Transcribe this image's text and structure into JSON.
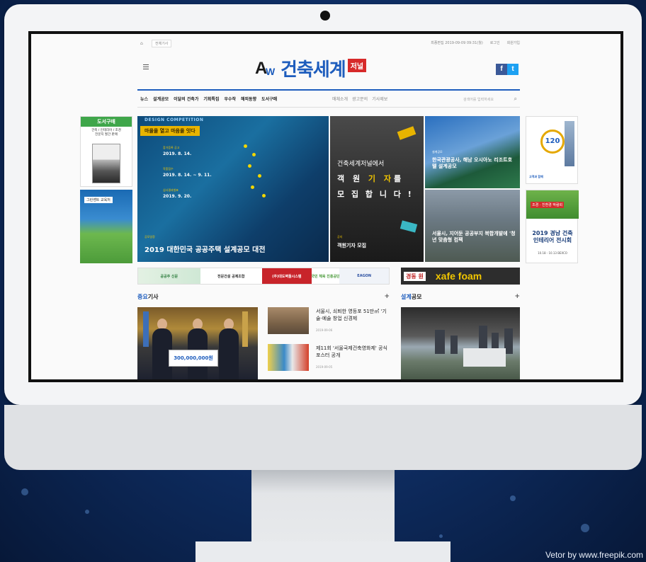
{
  "credit": "Vetor by www.freepik.com",
  "site": {
    "topbar": {
      "home_icon": "home-icon",
      "view_all": "전체기사",
      "right_links": [
        "최종편집 2019-09-09 09:31(월)",
        "로그인",
        "회원가입"
      ]
    },
    "logo": {
      "mark_a": "A",
      "mark_w": "W",
      "name": "건축세계",
      "badge": "저널"
    },
    "social": {
      "facebook": "f",
      "twitter": "t"
    },
    "nav": {
      "items": [
        "뉴스",
        "설계공모",
        "이달의 건축가",
        "기획특집",
        "우수작",
        "해외동향",
        "도서구매"
      ],
      "sub_items": [
        "매체소개",
        "광고문의",
        "기사제보"
      ],
      "search_placeholder": "검색어를 입력하세요"
    },
    "ads_left": {
      "book_header": "도서구매",
      "book_sub": "건축 / 인테리어 / 조경\n전문지 월간 판매",
      "second_tag": "그린쌩트 교육처"
    },
    "ads_right": {
      "anniv_num": "120",
      "anniv_caption": "고객과 함께",
      "exhibit_highlight": "조경 · 친환경 박람회",
      "exhibit_title": "2019 경남 건축\n인테리어 전시회",
      "exhibit_date": "10.18 - 10.13  BEXCO"
    },
    "hero": {
      "main": {
        "label": "DESIGN COMPETITION",
        "slogan": "마을을 열고 마음을 잇다",
        "schedule": [
          {
            "stage": "참가등록 공고",
            "date": "2019. 8. 14."
          },
          {
            "stage": "작품접수",
            "date": "2019. 8. 14. ~ 9. 11."
          },
          {
            "stage": "심사결과발표",
            "date": "2019. 9. 20."
          }
        ],
        "category": "공모일정",
        "title": "2019 대한민국 공공주택 설계공모 대전"
      },
      "middle": {
        "line1": "건축세계저널에서",
        "line2_a": "객 원 ",
        "line2_b": "기 자",
        "line2_c": "를",
        "line3": "모 집 합 니 다 !",
        "category": "공지",
        "caption": "객원기자 모집"
      },
      "right_top": {
        "category": "설계공모",
        "caption": "한국관광공사, 해남 오시아노 리조트호텔 설계공모"
      },
      "right_bottom": {
        "caption": "서울시, 지어둔 공공부지 복합개발에 '청년 맞춤형 컴팩"
      }
    },
    "banners": [
      "공공주 신문",
      "전문건설 공제조합",
      "(주)대도벽돌시스템",
      "국민 체육 진흥공단",
      "EAGON"
    ],
    "xafe": {
      "badge": "경동 원",
      "brand": "xafe foam"
    },
    "sections": {
      "main_prefix": "중요",
      "main_rest": "기사",
      "design_prefix": "설계",
      "design_rest": "공모",
      "plus": "+"
    },
    "articles": [
      {
        "title": "서울시, 쇠퇴한 영등포 51만㎡ '기술·예술 창업 신경제",
        "date": "2019-09-06"
      },
      {
        "title": "제11회 '서울국제건축영화제' 공식 포스터 공개",
        "date": "2019-09-05"
      }
    ],
    "main_photo_check": "300,000,000원"
  },
  "colors": {
    "brand_blue": "#1e5dbd",
    "badge_red": "#d72a2a",
    "accent_yellow": "#f2c600"
  }
}
